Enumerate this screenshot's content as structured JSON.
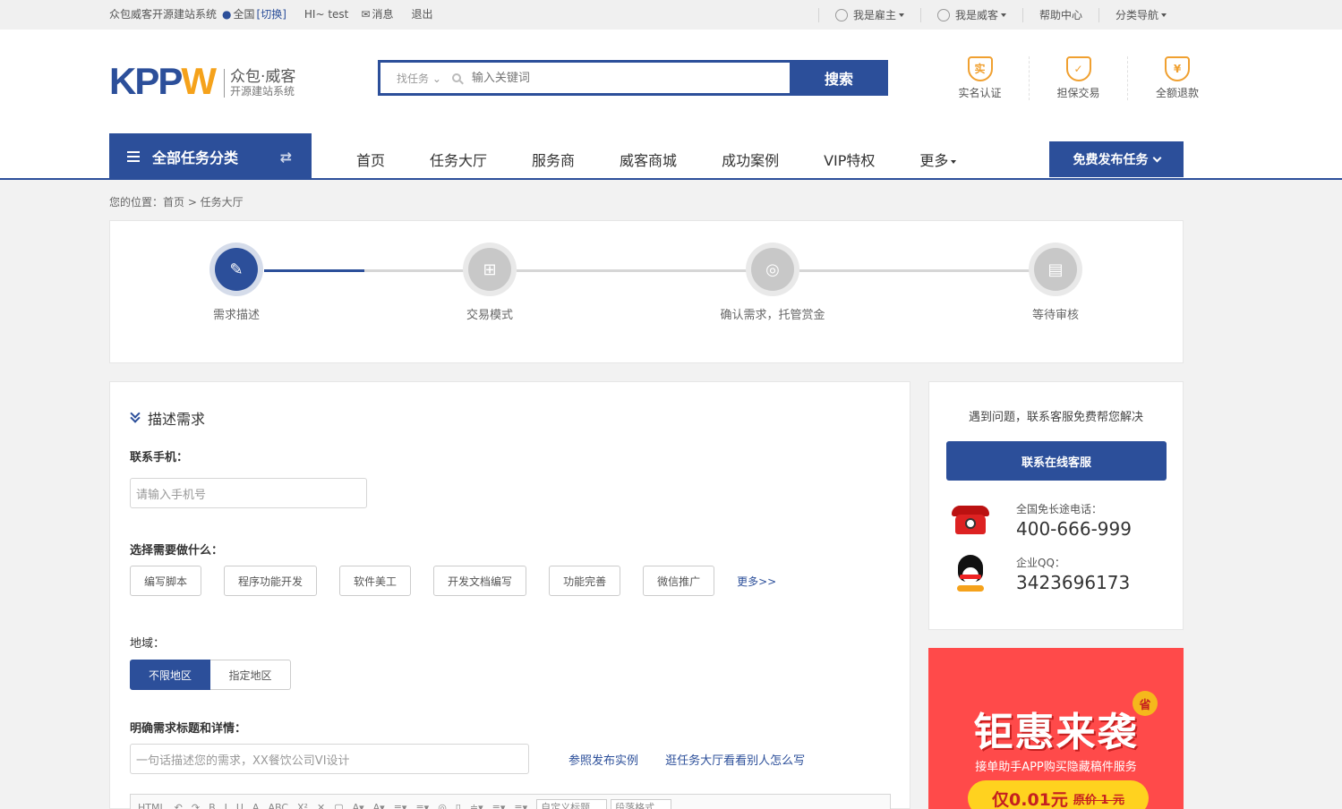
{
  "topbar": {
    "site_name": "众包威客开源建站系统",
    "location": "全国",
    "switch": "[切换]",
    "greeting": "HI~ test",
    "messages": "消息",
    "logout": "退出",
    "employer": "我是雇主",
    "worker": "我是威客",
    "help": "帮助中心",
    "category_nav": "分类导航"
  },
  "logo": {
    "brand": "KPPW",
    "line1": "众包·威客",
    "line2": "开源建站系统"
  },
  "search": {
    "category": "找任务",
    "placeholder": "输入关键词",
    "button": "搜索"
  },
  "guarantees": [
    {
      "icon": "实",
      "label": "实名认证"
    },
    {
      "icon": "✓",
      "label": "担保交易"
    },
    {
      "icon": "¥",
      "label": "全额退款"
    }
  ],
  "nav": {
    "all_categories": "全部任务分类",
    "links": [
      "首页",
      "任务大厅",
      "服务商",
      "威客商城",
      "成功案例",
      "VIP特权",
      "更多"
    ],
    "publish": "免费发布任务"
  },
  "breadcrumb": "您的位置：首页 > 任务大厅",
  "steps": [
    {
      "label": "需求描述",
      "active": true
    },
    {
      "label": "交易模式",
      "active": false
    },
    {
      "label": "确认需求，托管赏金",
      "active": false
    },
    {
      "label": "等待审核",
      "active": false
    }
  ],
  "form": {
    "section_title": "描述需求",
    "phone_label": "联系手机：",
    "phone_placeholder": "请输入手机号",
    "what_label": "选择需要做什么：",
    "options": [
      "编写脚本",
      "程序功能开发",
      "软件美工",
      "开发文档编写",
      "功能完善",
      "微信推广"
    ],
    "more": "更多>>",
    "region_label": "地域：",
    "region_unlimited": "不限地区",
    "region_specific": "指定地区",
    "title_label": "明确需求标题和详情：",
    "title_placeholder": "一句话描述您的需求，XX餐饮公司VI设计",
    "example_link": "参照发布实例",
    "browse_link": "逛任务大厅看看别人怎么写",
    "editor_heading": "自定义标题",
    "editor_format": "段落格式"
  },
  "sidebar": {
    "tip": "遇到问题，联系客服免费帮您解决",
    "service_button": "联系在线客服",
    "phone_label": "全国免长途电话：",
    "phone": "400-666-999",
    "qq_label": "企业QQ：",
    "qq": "3423696173"
  },
  "promo": {
    "headline": "钜惠来袭",
    "badge": "省",
    "subtitle": "接单助手APP购买隐藏稿件服务",
    "price": "仅0.01元",
    "original": "原价 1 元"
  },
  "colors": {
    "brand": "#2c4f9a",
    "accent": "#f5a21b",
    "promo": "#ff4a4a"
  }
}
